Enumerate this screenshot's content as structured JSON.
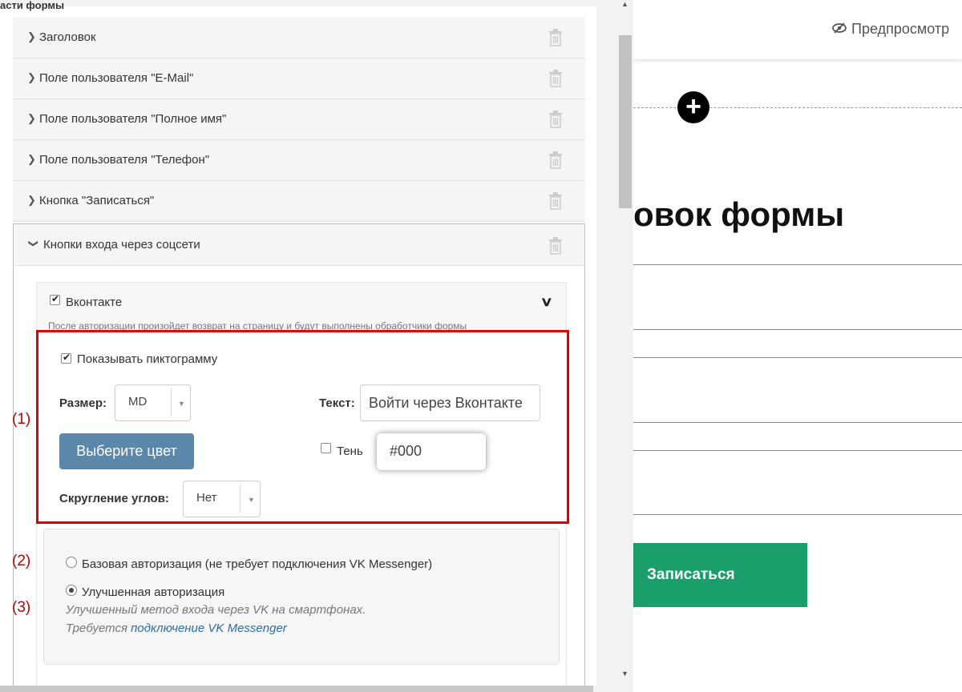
{
  "panel": {
    "section_title": "асти формы",
    "items": [
      {
        "label": "Заголовок"
      },
      {
        "label": "Поле пользователя \"E-Mail\""
      },
      {
        "label": "Поле пользователя \"Полное имя\""
      },
      {
        "label": "Поле пользователя \"Телефон\""
      },
      {
        "label": "Кнопка \"Записаться\""
      }
    ],
    "open_item": {
      "label": "Кнопки входа через соцсети"
    },
    "vk": {
      "label": "Вконтакте",
      "enabled": true,
      "note": "После авторизации произойдет возврат на страницу и будут выполнены обработчики формы",
      "show_icon_label": "Показывать пиктограмму",
      "show_icon": true,
      "size_label": "Размер:",
      "size_value": "MD",
      "text_label": "Текст:",
      "text_value": "Войти через Вконтакте",
      "color_button": "Выберите цвет",
      "shadow_label": "Тень",
      "shadow_enabled": false,
      "shadow_color": "#000",
      "rounding_label": "Скругление углов:",
      "rounding_value": "Нет"
    },
    "auth": {
      "basic_label": "Базовая авторизация (не требует подключения VK Messenger)",
      "improved_label": "Улучшенная авторизация",
      "selected": "improved",
      "desc_line1": "Улучшенный метод входа через VK на смартфонах.",
      "desc_line2_prefix": "Требуется",
      "desc_link": "подключение VK Messenger"
    },
    "callouts": [
      "(1)",
      "(2)",
      "(3)"
    ]
  },
  "preview": {
    "preview_button": "Предпросмотр",
    "form_title": "овок формы",
    "submit_label": "Записаться"
  },
  "colors": {
    "highlight": "#e00000",
    "color_button_bg": "#5b87ab",
    "submit_bg": "#1a9e6a",
    "link": "#2e6da4"
  }
}
